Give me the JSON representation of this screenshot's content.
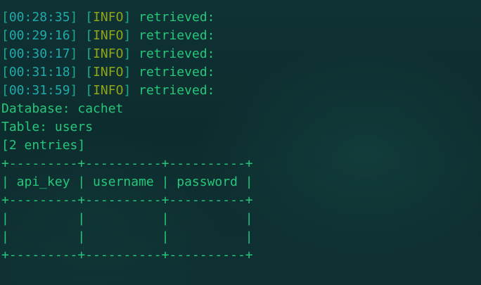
{
  "terminal": {
    "log_lines": [
      {
        "time": "00:28:35",
        "level": "INFO",
        "message": " retrieved:"
      },
      {
        "time": "00:29:16",
        "level": "INFO",
        "message": " retrieved:"
      },
      {
        "time": "00:30:17",
        "level": "INFO",
        "message": " retrieved:"
      },
      {
        "time": "00:31:18",
        "level": "INFO",
        "message": " retrieved:"
      },
      {
        "time": "00:31:59",
        "level": "INFO",
        "message": " retrieved:"
      }
    ],
    "database_line": "Database: cachet",
    "table_line": "Table: users",
    "entries_line": "[2 entries]",
    "table": {
      "border_top": "+---------+----------+----------+",
      "header_row": "| api_key | username | password |",
      "border_mid": "+---------+----------+----------+",
      "empty_rows": [
        "|         |          |          |",
        "|         |          |          |"
      ],
      "border_bottom": "+---------+----------+----------+",
      "columns": [
        "api_key",
        "username",
        "password"
      ]
    }
  },
  "colors": {
    "background": "#0e2f31",
    "timestamp": "#21a9a9",
    "level": "#8fa51a",
    "text": "#26c77a"
  }
}
